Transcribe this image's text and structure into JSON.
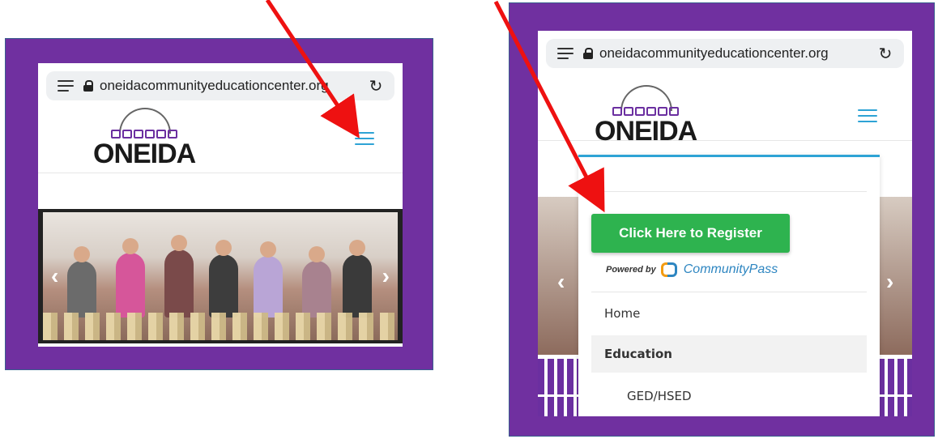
{
  "left_screen": {
    "url": "oneidacommunityeducationcenter.org",
    "logo_text": "ONEIDA"
  },
  "right_screen": {
    "url": "oneidacommunityeducationcenter.org",
    "logo_text": "ONEIDA",
    "register_label": "Click Here to Register",
    "powered_by": "Powered by",
    "provider": "CommunityPass",
    "menu": [
      {
        "label": "Home"
      },
      {
        "label": "Education"
      },
      {
        "label": "GED/HSED"
      }
    ]
  },
  "colors": {
    "frame_purple": "#7030a0",
    "accent_blue": "#2ea3d5",
    "register_green": "#2eb34f",
    "annotation_red": "#ee1111"
  },
  "icons": [
    "reader-menu-icon",
    "lock-icon",
    "reload-icon",
    "hamburger-menu-icon",
    "chevron-left-icon",
    "chevron-right-icon"
  ]
}
